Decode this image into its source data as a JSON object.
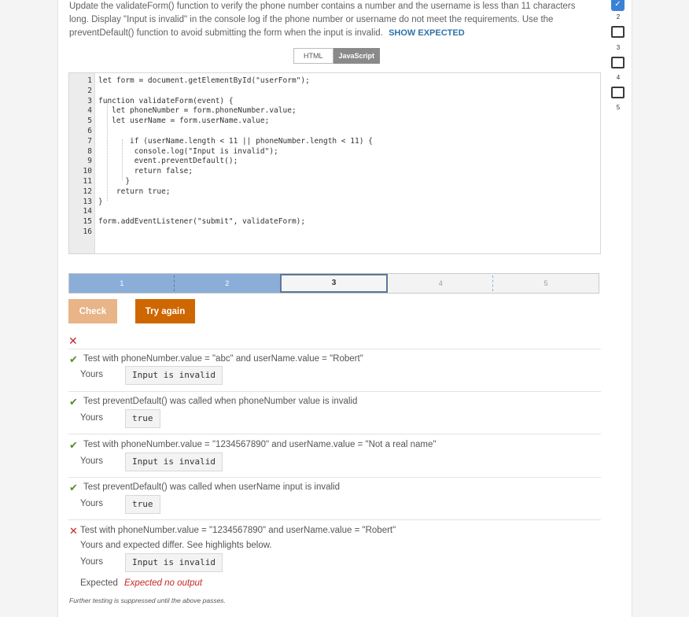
{
  "instructions": {
    "text": "Update the validateForm() function to verify the phone number contains a number and the username is less than 11 characters long. Display \"Input is invalid\" in the console log if the phone number or username do not meet the requirements. Use the preventDefault() function to avoid submitting the form when the input is invalid.",
    "show_expected": "SHOW EXPECTED"
  },
  "lang_tabs": {
    "html": "HTML",
    "javascript": "JavaScript"
  },
  "code": {
    "lines": [
      "let form = document.getElementById(\"userForm\");",
      "",
      "function validateForm(event) {",
      "   let phoneNumber = form.phoneNumber.value;",
      "   let userName = form.userName.value;",
      "",
      "       if (userName.length < 11 || phoneNumber.length < 11) {",
      "        console.log(\"Input is invalid\");",
      "        event.preventDefault();",
      "        return false;",
      "      }",
      "    return true;",
      "}",
      "",
      "form.addEventListener(\"submit\", validateForm);",
      ""
    ]
  },
  "progress": {
    "segments": [
      "1",
      "2",
      "3",
      "4",
      "5"
    ],
    "current": 3,
    "completed": 2
  },
  "buttons": {
    "check": "Check",
    "try_again": "Try again"
  },
  "results": {
    "overall_mark": "✕",
    "tests": [
      {
        "mark": "✔",
        "title": "Test with phoneNumber.value = \"abc\" and userName.value = \"Robert\"",
        "yours_label": "Yours",
        "yours": "Input is invalid"
      },
      {
        "mark": "✔",
        "title": "Test preventDefault() was called when phoneNumber value is invalid",
        "yours_label": "Yours",
        "yours": "true"
      },
      {
        "mark": "✔",
        "title": "Test with phoneNumber.value = \"1234567890\" and userName.value = \"Not a real name\"",
        "yours_label": "Yours",
        "yours": "Input is invalid"
      },
      {
        "mark": "✔",
        "title": "Test preventDefault() was called when userName input is invalid",
        "yours_label": "Yours",
        "yours": "true"
      },
      {
        "mark": "✕",
        "title": "Test with phoneNumber.value = \"1234567890\" and userName.value = \"Robert\"",
        "note": "Yours and expected differ. See highlights below.",
        "yours_label": "Yours",
        "yours": "Input is invalid",
        "expected_label": "Expected",
        "expected": "Expected no output"
      }
    ],
    "footer": "Further testing is suppressed until the above passes."
  },
  "sidebar": {
    "check_mark": "✓",
    "numbers": [
      "2",
      "3",
      "4",
      "5"
    ]
  },
  "colors": {
    "accent_blue": "#3b82d6",
    "progress_done": "#8aaed8",
    "check_button": "#e8b488",
    "try_button": "#cf6700",
    "fail_red": "#c62828",
    "pass_green": "#5b8a2d"
  }
}
